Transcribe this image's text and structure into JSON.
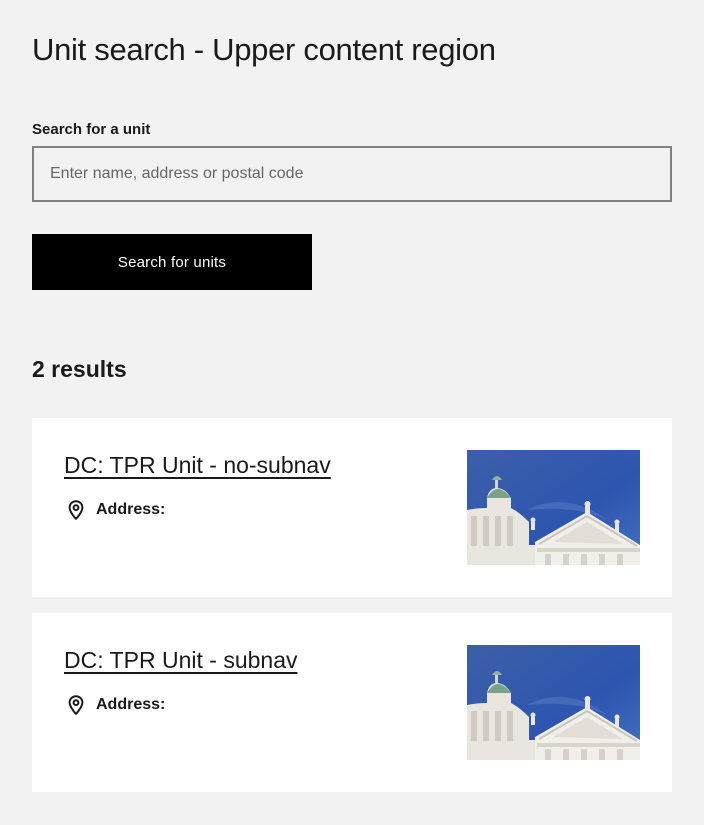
{
  "page": {
    "title": "Unit search - Upper content region"
  },
  "search": {
    "label": "Search for a unit",
    "placeholder": "Enter name, address or postal code",
    "value": "",
    "button_label": "Search for units"
  },
  "results": {
    "count_text": "2 results",
    "items": [
      {
        "title": "DC: TPR Unit - no-subnav",
        "address_label": "Address:",
        "icon": "location-pin-icon",
        "image": "helsinki-cathedral-photo"
      },
      {
        "title": "DC: TPR Unit - subnav",
        "address_label": "Address:",
        "icon": "location-pin-icon",
        "image": "helsinki-cathedral-photo"
      }
    ]
  },
  "colors": {
    "background": "#f2f2f2",
    "card_background": "#ffffff",
    "button_background": "#000000",
    "button_text": "#ffffff",
    "input_border": "#808080",
    "text": "#1a1a1a"
  }
}
